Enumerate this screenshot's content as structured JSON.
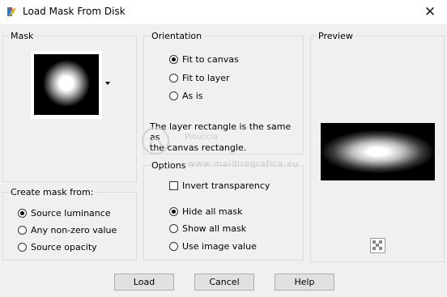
{
  "window": {
    "title": "Load Mask From Disk",
    "close": "✕"
  },
  "mask_group": {
    "label": "Mask"
  },
  "create_group": {
    "label": "Create mask from:",
    "options": [
      {
        "label": "Source luminance",
        "selected": true
      },
      {
        "label": "Any non-zero value",
        "selected": false
      },
      {
        "label": "Source opacity",
        "selected": false
      }
    ]
  },
  "orientation_group": {
    "label": "Orientation",
    "options": [
      {
        "label": "Fit to canvas",
        "selected": true
      },
      {
        "label": "Fit to layer",
        "selected": false
      },
      {
        "label": "As is",
        "selected": false
      }
    ],
    "info_line1": "The layer rectangle is the same as",
    "info_line2": "the canvas rectangle."
  },
  "options_group": {
    "label": "Options",
    "invert": {
      "label": "Invert transparency",
      "checked": false
    },
    "options": [
      {
        "label": "Hide all mask",
        "selected": true
      },
      {
        "label": "Show all mask",
        "selected": false
      },
      {
        "label": "Use image value",
        "selected": false
      }
    ]
  },
  "preview_group": {
    "label": "Preview"
  },
  "watermark": {
    "name": "Pinuccia",
    "site": "www.maidiregrafica.eu"
  },
  "buttons": {
    "load": "Load",
    "cancel": "Cancel",
    "help": "Help"
  }
}
